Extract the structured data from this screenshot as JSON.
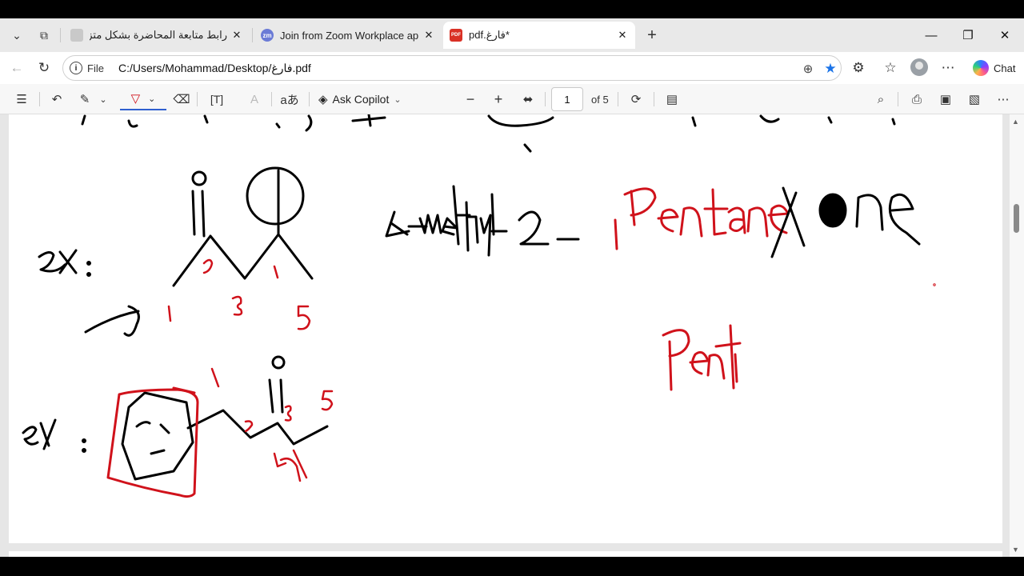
{
  "browser": {
    "tabs": [
      {
        "title": "رابط متابعة المحاضرة بشكل متزامن",
        "favicon": "page-icon",
        "active": false
      },
      {
        "title": "Join from Zoom Workplace app - Z",
        "favicon": "zoom-icon",
        "favicon_text": "zm",
        "active": false
      },
      {
        "title": "*فارغ.pdf",
        "favicon": "pdf-icon",
        "favicon_text": "PDF",
        "active": true
      }
    ],
    "new_tab_icon": "plus-icon",
    "window_controls": {
      "minimize": "—",
      "restore": "❐",
      "close": "✕"
    },
    "address": {
      "scheme_label": "File",
      "url": "C:/Users/Mohammad/Desktop/فارغ.pdf"
    },
    "chat_label": "Chat"
  },
  "pdf_toolbar": {
    "ask_copilot_label": "Ask Copilot",
    "page_number": "1",
    "page_total_label": "of 5"
  },
  "document": {
    "handwriting": {
      "example_label_1": "ex :",
      "example_label_2": "ex :",
      "name_text": "4 methyl - 2 - Pentanone",
      "correction_text": "Pent",
      "carbon_numbers_1": [
        "1",
        "2",
        "3",
        "4",
        "5"
      ],
      "carbon_numbers_2": [
        "1",
        "2",
        "3",
        "4",
        "5"
      ]
    },
    "ink_colors": {
      "black": "#000000",
      "red": "#d0121b"
    }
  },
  "colors": {
    "accent": "#2f5fd0",
    "favorite_star": "#1a73e8",
    "pdf_red": "#d93025"
  }
}
